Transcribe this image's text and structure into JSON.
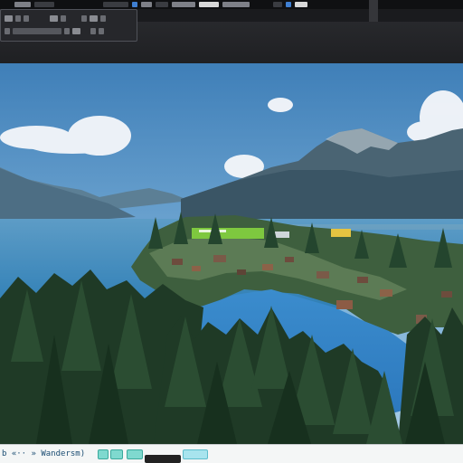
{
  "toolbar": {
    "icons": [
      "layer-icon",
      "brush-icon",
      "terrain-icon",
      "camera-icon",
      "settings-icon"
    ]
  },
  "status": {
    "text": "b «·· » Wandersm)"
  },
  "colors": {
    "toolbar_bg": "#2c2d31",
    "status_bg": "#f4f6f6",
    "status_text": "#1b4d73",
    "accent_teal": "#7fd9cf",
    "label_green": "#7ec83f",
    "label_yellow": "#e5c341"
  }
}
